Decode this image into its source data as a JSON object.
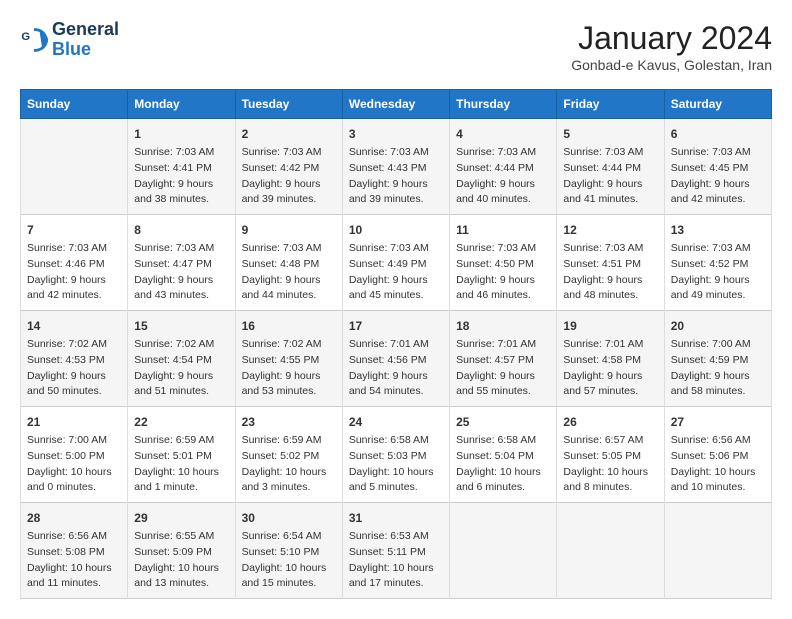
{
  "logo": {
    "text_general": "General",
    "text_blue": "Blue"
  },
  "title": {
    "month_year": "January 2024",
    "location": "Gonbad-e Kavus, Golestan, Iran"
  },
  "header": {
    "days": [
      "Sunday",
      "Monday",
      "Tuesday",
      "Wednesday",
      "Thursday",
      "Friday",
      "Saturday"
    ]
  },
  "weeks": [
    [
      {
        "day": "",
        "info": ""
      },
      {
        "day": "1",
        "info": "Sunrise: 7:03 AM\nSunset: 4:41 PM\nDaylight: 9 hours\nand 38 minutes."
      },
      {
        "day": "2",
        "info": "Sunrise: 7:03 AM\nSunset: 4:42 PM\nDaylight: 9 hours\nand 39 minutes."
      },
      {
        "day": "3",
        "info": "Sunrise: 7:03 AM\nSunset: 4:43 PM\nDaylight: 9 hours\nand 39 minutes."
      },
      {
        "day": "4",
        "info": "Sunrise: 7:03 AM\nSunset: 4:44 PM\nDaylight: 9 hours\nand 40 minutes."
      },
      {
        "day": "5",
        "info": "Sunrise: 7:03 AM\nSunset: 4:44 PM\nDaylight: 9 hours\nand 41 minutes."
      },
      {
        "day": "6",
        "info": "Sunrise: 7:03 AM\nSunset: 4:45 PM\nDaylight: 9 hours\nand 42 minutes."
      }
    ],
    [
      {
        "day": "7",
        "info": "Sunrise: 7:03 AM\nSunset: 4:46 PM\nDaylight: 9 hours\nand 42 minutes."
      },
      {
        "day": "8",
        "info": "Sunrise: 7:03 AM\nSunset: 4:47 PM\nDaylight: 9 hours\nand 43 minutes."
      },
      {
        "day": "9",
        "info": "Sunrise: 7:03 AM\nSunset: 4:48 PM\nDaylight: 9 hours\nand 44 minutes."
      },
      {
        "day": "10",
        "info": "Sunrise: 7:03 AM\nSunset: 4:49 PM\nDaylight: 9 hours\nand 45 minutes."
      },
      {
        "day": "11",
        "info": "Sunrise: 7:03 AM\nSunset: 4:50 PM\nDaylight: 9 hours\nand 46 minutes."
      },
      {
        "day": "12",
        "info": "Sunrise: 7:03 AM\nSunset: 4:51 PM\nDaylight: 9 hours\nand 48 minutes."
      },
      {
        "day": "13",
        "info": "Sunrise: 7:03 AM\nSunset: 4:52 PM\nDaylight: 9 hours\nand 49 minutes."
      }
    ],
    [
      {
        "day": "14",
        "info": "Sunrise: 7:02 AM\nSunset: 4:53 PM\nDaylight: 9 hours\nand 50 minutes."
      },
      {
        "day": "15",
        "info": "Sunrise: 7:02 AM\nSunset: 4:54 PM\nDaylight: 9 hours\nand 51 minutes."
      },
      {
        "day": "16",
        "info": "Sunrise: 7:02 AM\nSunset: 4:55 PM\nDaylight: 9 hours\nand 53 minutes."
      },
      {
        "day": "17",
        "info": "Sunrise: 7:01 AM\nSunset: 4:56 PM\nDaylight: 9 hours\nand 54 minutes."
      },
      {
        "day": "18",
        "info": "Sunrise: 7:01 AM\nSunset: 4:57 PM\nDaylight: 9 hours\nand 55 minutes."
      },
      {
        "day": "19",
        "info": "Sunrise: 7:01 AM\nSunset: 4:58 PM\nDaylight: 9 hours\nand 57 minutes."
      },
      {
        "day": "20",
        "info": "Sunrise: 7:00 AM\nSunset: 4:59 PM\nDaylight: 9 hours\nand 58 minutes."
      }
    ],
    [
      {
        "day": "21",
        "info": "Sunrise: 7:00 AM\nSunset: 5:00 PM\nDaylight: 10 hours\nand 0 minutes."
      },
      {
        "day": "22",
        "info": "Sunrise: 6:59 AM\nSunset: 5:01 PM\nDaylight: 10 hours\nand 1 minute."
      },
      {
        "day": "23",
        "info": "Sunrise: 6:59 AM\nSunset: 5:02 PM\nDaylight: 10 hours\nand 3 minutes."
      },
      {
        "day": "24",
        "info": "Sunrise: 6:58 AM\nSunset: 5:03 PM\nDaylight: 10 hours\nand 5 minutes."
      },
      {
        "day": "25",
        "info": "Sunrise: 6:58 AM\nSunset: 5:04 PM\nDaylight: 10 hours\nand 6 minutes."
      },
      {
        "day": "26",
        "info": "Sunrise: 6:57 AM\nSunset: 5:05 PM\nDaylight: 10 hours\nand 8 minutes."
      },
      {
        "day": "27",
        "info": "Sunrise: 6:56 AM\nSunset: 5:06 PM\nDaylight: 10 hours\nand 10 minutes."
      }
    ],
    [
      {
        "day": "28",
        "info": "Sunrise: 6:56 AM\nSunset: 5:08 PM\nDaylight: 10 hours\nand 11 minutes."
      },
      {
        "day": "29",
        "info": "Sunrise: 6:55 AM\nSunset: 5:09 PM\nDaylight: 10 hours\nand 13 minutes."
      },
      {
        "day": "30",
        "info": "Sunrise: 6:54 AM\nSunset: 5:10 PM\nDaylight: 10 hours\nand 15 minutes."
      },
      {
        "day": "31",
        "info": "Sunrise: 6:53 AM\nSunset: 5:11 PM\nDaylight: 10 hours\nand 17 minutes."
      },
      {
        "day": "",
        "info": ""
      },
      {
        "day": "",
        "info": ""
      },
      {
        "day": "",
        "info": ""
      }
    ]
  ]
}
